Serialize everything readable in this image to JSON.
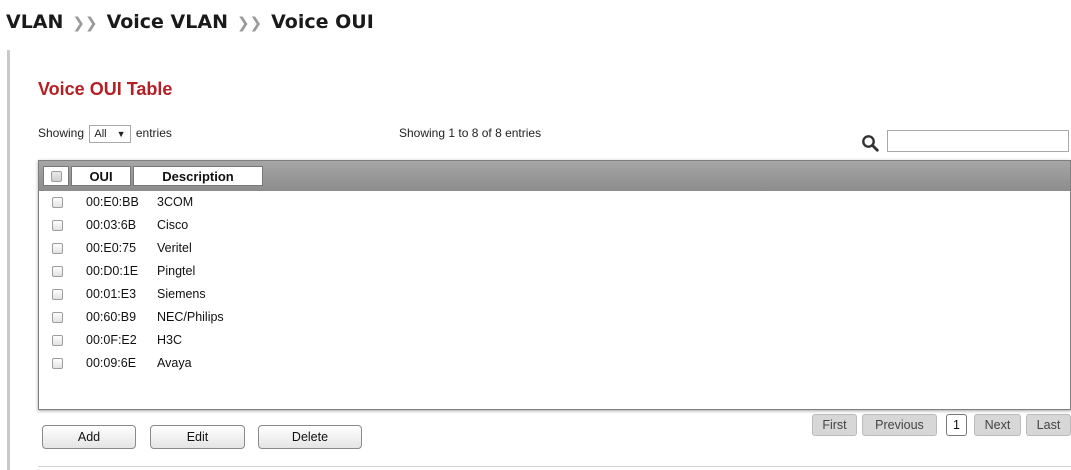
{
  "breadcrumb": {
    "items": [
      "VLAN",
      "Voice VLAN",
      "Voice OUI"
    ],
    "separator": "»"
  },
  "card": {
    "title": "Voice OUI Table"
  },
  "controls": {
    "showing_prefix": "Showing",
    "page_size_value": "All",
    "showing_suffix": "entries",
    "info_text": "Showing 1 to 8 of 8 entries",
    "search_value": ""
  },
  "table": {
    "columns": {
      "oui": "OUI",
      "description": "Description"
    },
    "rows": [
      {
        "oui": "00:E0:BB",
        "description": "3COM"
      },
      {
        "oui": "00:03:6B",
        "description": "Cisco"
      },
      {
        "oui": "00:E0:75",
        "description": "Veritel"
      },
      {
        "oui": "00:D0:1E",
        "description": "Pingtel"
      },
      {
        "oui": "00:01:E3",
        "description": "Siemens"
      },
      {
        "oui": "00:60:B9",
        "description": "NEC/Philips"
      },
      {
        "oui": "00:0F:E2",
        "description": "H3C"
      },
      {
        "oui": "00:09:6E",
        "description": "Avaya"
      }
    ]
  },
  "actions": {
    "add": "Add",
    "edit": "Edit",
    "delete": "Delete"
  },
  "pagination": {
    "first": "First",
    "previous": "Previous",
    "current_page": "1",
    "next": "Next",
    "last": "Last"
  },
  "colors": {
    "title_red": "#b51f24",
    "header_gray": "#999999"
  },
  "icons": {
    "search": "magnifier-icon",
    "dropdown": "triangle-down-icon"
  }
}
